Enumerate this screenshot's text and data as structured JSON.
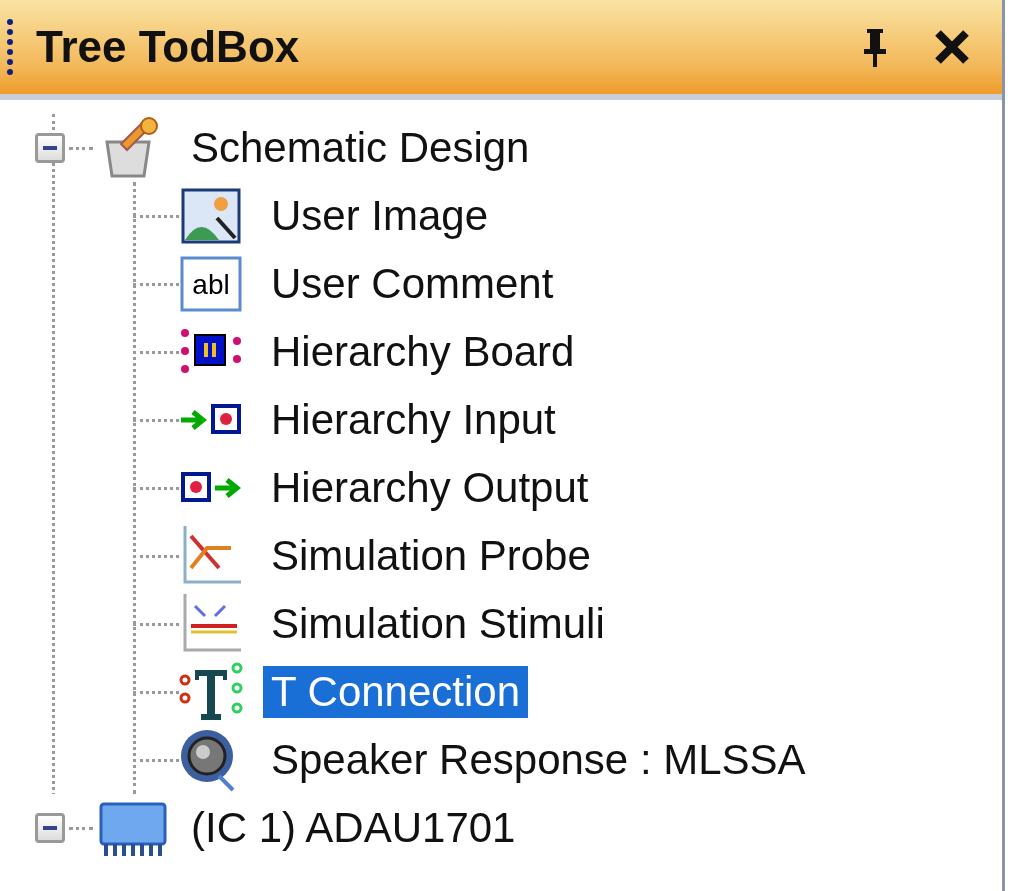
{
  "panel": {
    "title": "Tree TodBox"
  },
  "tree": [
    {
      "label": "Schematic Design",
      "kind": "design",
      "expanded": true,
      "selected": false,
      "children": [
        {
          "label": "User Image",
          "kind": "image",
          "selected": false
        },
        {
          "label": "User Comment",
          "kind": "comment",
          "icon_text": "abl",
          "selected": false
        },
        {
          "label": "Hierarchy Board",
          "kind": "board",
          "selected": false
        },
        {
          "label": "Hierarchy Input",
          "kind": "input",
          "selected": false
        },
        {
          "label": "Hierarchy Output",
          "kind": "output",
          "selected": false
        },
        {
          "label": "Simulation Probe",
          "kind": "probe",
          "selected": false
        },
        {
          "label": "Simulation Stimuli",
          "kind": "stimuli",
          "selected": false
        },
        {
          "label": "T Connection",
          "kind": "tconn",
          "selected": true
        },
        {
          "label": "Speaker Response : MLSSA",
          "kind": "speaker",
          "selected": false
        }
      ]
    },
    {
      "label": "(IC 1) ADAU1701",
      "kind": "chip",
      "expanded": true,
      "selected": false
    }
  ]
}
